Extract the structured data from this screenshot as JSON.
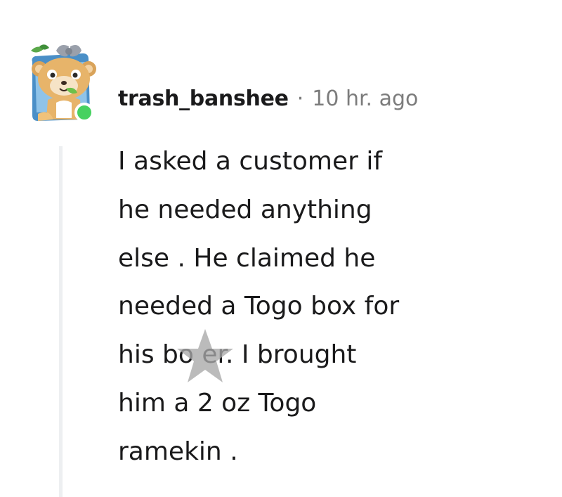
{
  "comment": {
    "author": "trash_banshee",
    "separator": "·",
    "timestamp": "10 hr. ago",
    "avatar": {
      "icon": "bear-avatar-icon",
      "online_status": "online",
      "online_color": "#46d160"
    },
    "body_lines": [
      "I asked a customer if",
      "he needed anything",
      "else . He claimed he",
      "needed a Togo box for",
      "his bo  er. I brought",
      "him a 2 oz Togo",
      "ramekin ."
    ]
  },
  "overlay": {
    "icon": "star-watermark-icon",
    "color": "#a8a8a8"
  },
  "colors": {
    "text": "#1a1a1b",
    "meta": "#7c7c7c",
    "thread_line": "#edeff1"
  }
}
